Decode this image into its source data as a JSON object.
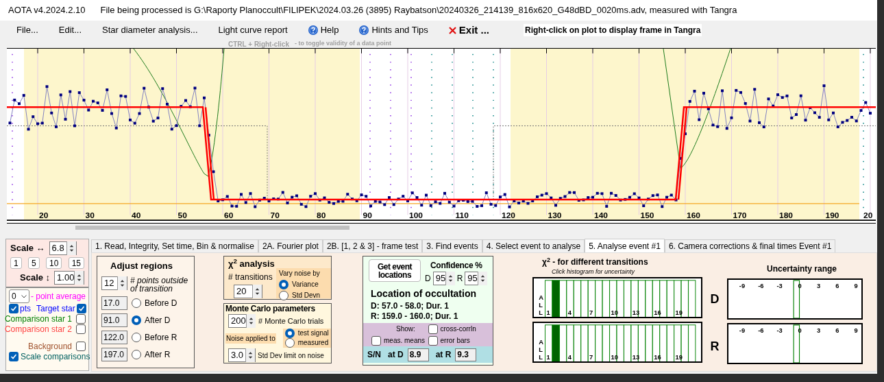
{
  "window": {
    "title": "AOTA v4.2024.2.10",
    "file_info": "File being processed is G:\\Raporty Planoccult\\FILIPEK\\2024.03.26 (3895) Raybatson\\20240326_214139_816x620_G48dBD_0020ms.adv, measured with Tangra"
  },
  "menu": [
    {
      "label": "File...",
      "kind": "plain"
    },
    {
      "label": "Edit...",
      "kind": "plain"
    },
    {
      "label": "Star diameter analysis...",
      "kind": "plain"
    },
    {
      "label": "Light curve report",
      "kind": "plain"
    },
    {
      "label": "Help",
      "kind": "help"
    },
    {
      "label": "Hints and Tips",
      "kind": "help"
    },
    {
      "label": "Exit ...",
      "kind": "exit"
    }
  ],
  "plot_hint": "Right-click on plot to display frame in Tangra",
  "toggle_hint": {
    "key": "CTRL + Right-click",
    "text": "-  to toggle validity of a data point"
  },
  "plot": {
    "x_labels": [
      "20",
      "30",
      "40",
      "50",
      "60",
      "70",
      "80",
      "90",
      "100",
      "110",
      "120",
      "130",
      "140",
      "150",
      "160",
      "170",
      "180",
      "190",
      "20"
    ]
  },
  "scale_panel": {
    "horizontal_label": "Scale ↔",
    "horizontal_value": "6.8",
    "presets": [
      "1",
      "5",
      "10",
      "15"
    ],
    "vertical_label": "Scale ↕",
    "vertical_value": "1.00"
  },
  "display": {
    "average_value": "0",
    "average_label": "- point average",
    "pts_label": "pts",
    "pts_checked": true,
    "series": [
      {
        "label": "Target star",
        "color": "#0000ff",
        "checked": true
      },
      {
        "label": "Comparison star 1",
        "color": "#008000",
        "checked": false
      },
      {
        "label": "Comparison star 2",
        "color": "#ff4040",
        "checked": false
      },
      {
        "label": "Background",
        "color": "#a0522d",
        "checked": false
      }
    ],
    "scale_comparisons": {
      "label": "Scale comparisons",
      "checked": true
    }
  },
  "tabs": [
    {
      "label": "1.  Read, Integrity, Set time, Bin & normalise",
      "selected": false
    },
    {
      "label": "2A. Fourier plot",
      "selected": false
    },
    {
      "label": "2B. [1, 2 & 3] - frame test",
      "selected": false
    },
    {
      "label": "3. Find events",
      "selected": false
    },
    {
      "label": "4. Select event to analyse",
      "selected": false
    },
    {
      "label": "5. Analyse event #1",
      "selected": true
    },
    {
      "label": "6. Camera corrections & final times Event #1",
      "selected": false
    }
  ],
  "adjust_regions": {
    "title": "Adjust regions",
    "points_value": "12",
    "points_label": "# points outside of transition",
    "regions": [
      {
        "value": "17.0",
        "label": "Before D",
        "selected": false
      },
      {
        "value": "91.0",
        "label": "After D",
        "selected": true
      },
      {
        "value": "122.0",
        "label": "Before R",
        "selected": false
      },
      {
        "value": "197.0",
        "label": "After R",
        "selected": false
      }
    ]
  },
  "chi2": {
    "title": "χ$^{2}$ analysis",
    "transitions_label": "# transitions",
    "transitions_value": "20",
    "noise_title": "Vary noise by",
    "noise_options": [
      {
        "label": "Variance",
        "selected": true
      },
      {
        "label": "Std Devn",
        "selected": false
      }
    ]
  },
  "monte_carlo": {
    "title": "Monte Carlo parameters",
    "trials_value": "200",
    "trials_label": "# Monte Carlo trials",
    "noise_label": "Noise applied to",
    "noise_options": [
      {
        "label": "test signal",
        "selected": true
      },
      {
        "label": "measured",
        "selected": false
      }
    ],
    "limit_value": "3.0",
    "limit_label": "Std Dev limit on noise"
  },
  "location": {
    "button": "Get event locations",
    "confidence_label": "Confidence %",
    "confidence": [
      {
        "label": "D",
        "value": "95"
      },
      {
        "label": "R",
        "value": "95"
      }
    ],
    "title": "Location of occultation",
    "results": [
      "D: 57.0 - 58.0; Dur. 1",
      "R: 159.0 - 160.0; Dur. 1"
    ],
    "show_label": "Show:",
    "show_options": [
      {
        "label": "cross-corrln",
        "checked": false
      },
      {
        "label": "meas. means",
        "checked": false
      },
      {
        "label": "error bars",
        "checked": false
      }
    ],
    "sn_label": "S/N",
    "sn": [
      {
        "label": "at D",
        "value": "8.9"
      },
      {
        "label": "at R",
        "value": "9.3"
      }
    ]
  },
  "histograms": {
    "title": "χ$^{2}$ - for different transitions",
    "subtitle": "Click histogram for uncertainty",
    "uncertainty_title": "Uncertainty range",
    "events": [
      {
        "label": "D",
        "all_letters": [
          "A",
          "L",
          "L"
        ],
        "bar_labels": [
          "1",
          "4",
          "7",
          "10",
          "13",
          "16",
          "19"
        ],
        "uncertainty_labels": [
          "-9",
          "-6",
          "-3",
          "0",
          "3",
          "6",
          "9"
        ]
      },
      {
        "label": "R",
        "all_letters": [
          "A",
          "L",
          "L"
        ],
        "bar_labels": [
          "1",
          "4",
          "7",
          "10",
          "13",
          "16",
          "19"
        ],
        "uncertainty_labels": [
          "-9",
          "-6",
          "-3",
          "0",
          "3",
          "6",
          "9"
        ]
      }
    ]
  }
}
